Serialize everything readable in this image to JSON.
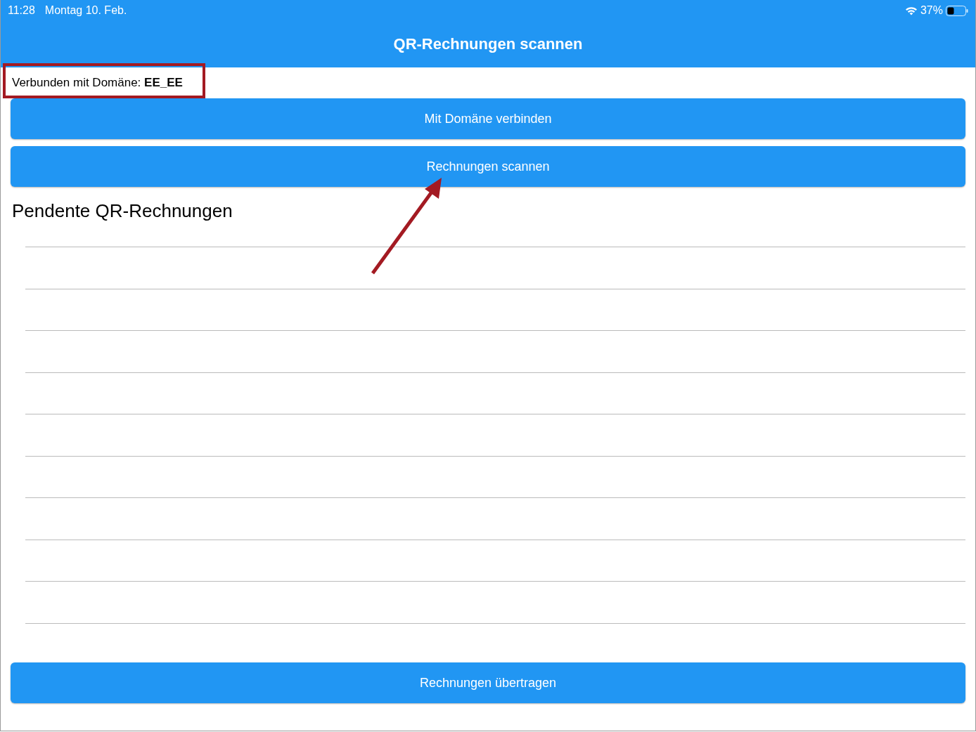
{
  "status_bar": {
    "time": "11:28",
    "date": "Montag 10. Feb.",
    "battery": "37%"
  },
  "title": "QR-Rechnungen scannen",
  "domain_label": "Verbunden mit Domäne: **EE_EE**",
  "buttons": [
    "Mit Domäne verbinden",
    "Rechnungen scannen"
  ],
  "section_heading": "Pendente QR-Rechnungen",
  "footer_button": "Rechnungen übertragen"
}
